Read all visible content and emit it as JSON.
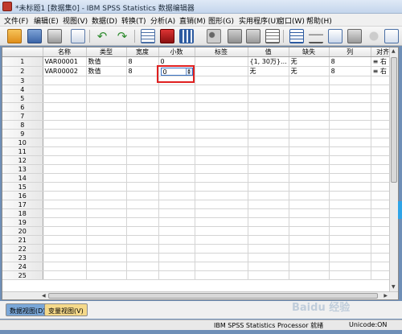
{
  "window": {
    "title": "*未标题1 [数据集0] - IBM SPSS Statistics 数据编辑器"
  },
  "menu": [
    "文件(F)",
    "编辑(E)",
    "视图(V)",
    "数据(D)",
    "转换(T)",
    "分析(A)",
    "直销(M)",
    "图形(G)",
    "实用程序(U)",
    "窗口(W)",
    "帮助(H)"
  ],
  "toolbar_icons": [
    "open-folder-icon",
    "save-icon",
    "print-icon",
    "dialog-recall-icon",
    "undo-icon",
    "redo-icon",
    "goto-case-icon",
    "goto-variable-icon",
    "variables-icon",
    "find-icon",
    "insert-cases-icon",
    "insert-variable-icon",
    "split-file-icon",
    "weight-cases-icon",
    "select-cases-icon",
    "value-labels-icon"
  ],
  "grid": {
    "headers": [
      "名称",
      "类型",
      "宽度",
      "小数",
      "标签",
      "值",
      "缺失",
      "列",
      "对齐"
    ],
    "rows": [
      {
        "num": "1",
        "name": "VAR00001",
        "type": "数值",
        "width": "8",
        "decimals": "0",
        "label": "",
        "values": "{1, 30万}...",
        "missing": "无",
        "columns": "8",
        "align": "右"
      },
      {
        "num": "2",
        "name": "VAR00002",
        "type": "数值",
        "width": "8",
        "decimals": "0",
        "label": "",
        "values": "无",
        "missing": "无",
        "columns": "8",
        "align": "右"
      }
    ],
    "empty_row_numbers": [
      "3",
      "4",
      "5",
      "6",
      "7",
      "8",
      "9",
      "10",
      "11",
      "12",
      "13",
      "14",
      "15",
      "16",
      "17",
      "18",
      "19",
      "20",
      "21",
      "22",
      "23",
      "24",
      "25"
    ]
  },
  "tabs": {
    "data_view": "数据视图(D)",
    "variable_view": "变量视图(V)"
  },
  "status": {
    "processor": "IBM SPSS Statistics Processor 就绪",
    "unicode": "Unicode:ON"
  },
  "watermark": "Baidu 经验",
  "colors": {
    "edit_highlight": "#e02020",
    "data_view_tab": "#7aa7d8",
    "variable_view_tab": "#f5d98a"
  }
}
